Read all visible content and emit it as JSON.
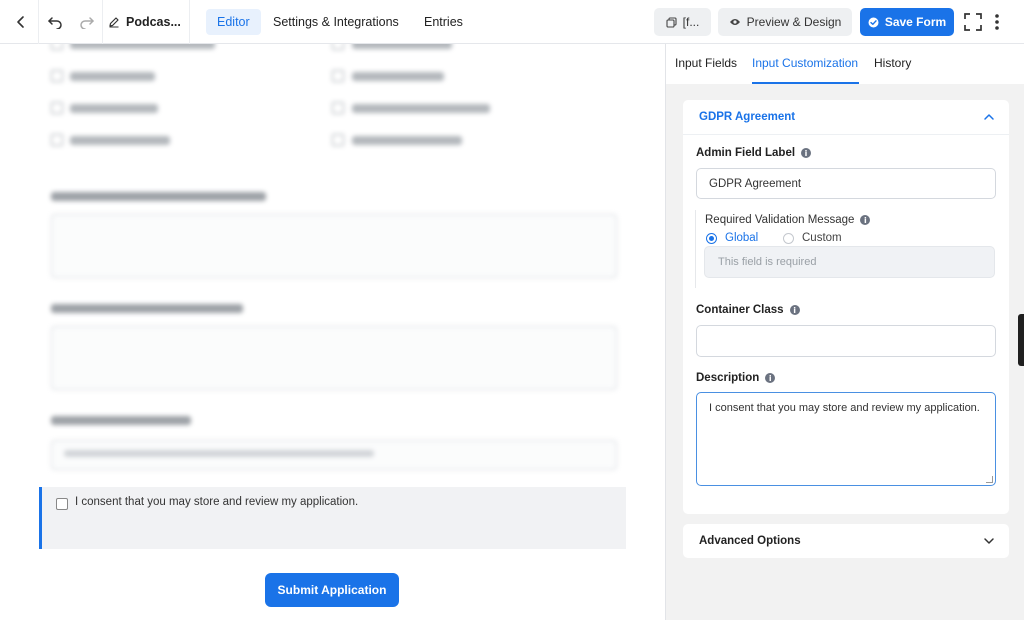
{
  "topbar": {
    "form_title": "Podcas...",
    "tabs": [
      "Editor",
      "Settings & Integrations",
      "Entries"
    ],
    "shortcode_label": "[f...",
    "preview_label": "Preview & Design",
    "save_label": "Save Form"
  },
  "form": {
    "consent_text": "I consent that you may store and review my application.",
    "submit_label": "Submit Application"
  },
  "panel": {
    "tabs": [
      "Input Fields",
      "Input Customization",
      "History"
    ],
    "section_title": "GDPR Agreement",
    "admin_label": "Admin Field Label",
    "admin_value": "GDPR Agreement",
    "validation_label": "Required Validation Message",
    "radio_global": "Global",
    "radio_custom": "Custom",
    "validation_placeholder": "This field is required",
    "container_label": "Container Class",
    "container_value": "",
    "description_label": "Description",
    "description_value": "I consent that you may store and review my application.",
    "advanced_label": "Advanced Options"
  },
  "colors": {
    "accent": "#1a73e8",
    "panel_bg": "#f2f2f2"
  }
}
